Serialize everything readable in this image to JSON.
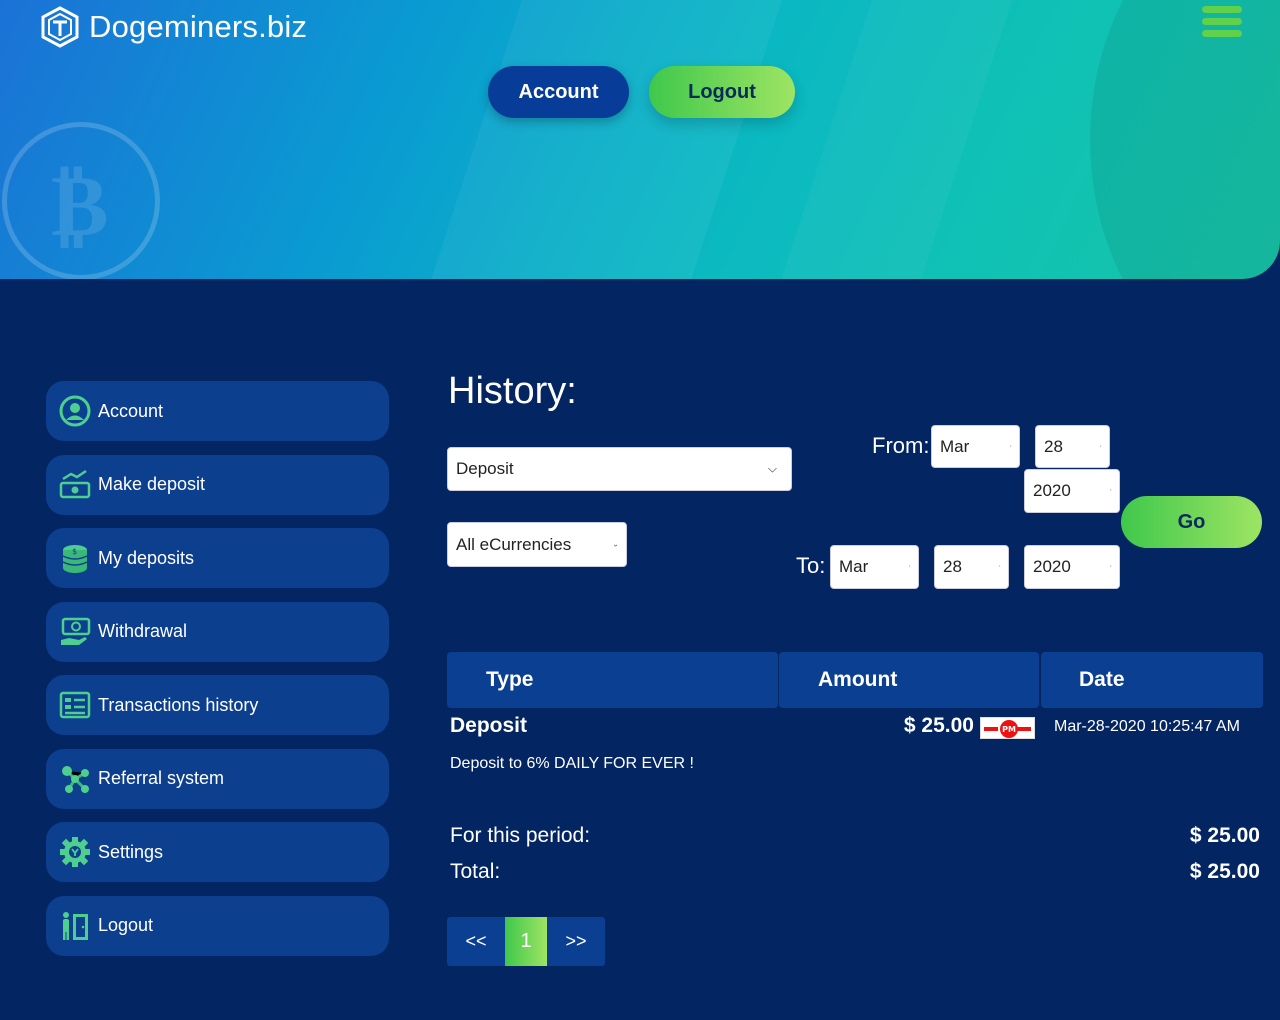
{
  "header": {
    "brand": "Dogeminers.biz",
    "account_button": "Account",
    "logout_button": "Logout"
  },
  "sidebar": {
    "items": [
      {
        "label": "Account",
        "icon": "user-circle-icon"
      },
      {
        "label": "Make deposit",
        "icon": "money-growth-icon"
      },
      {
        "label": "My deposits",
        "icon": "coin-stack-icon"
      },
      {
        "label": "Withdrawal",
        "icon": "cash-hand-icon"
      },
      {
        "label": "Transactions history",
        "icon": "list-icon"
      },
      {
        "label": "Referral system",
        "icon": "network-icon"
      },
      {
        "label": "Settings",
        "icon": "gear-icon"
      },
      {
        "label": "Logout",
        "icon": "door-exit-icon"
      }
    ]
  },
  "main": {
    "title": "History:",
    "type_select": "Deposit",
    "currency_select": "All eCurrencies",
    "from_label": "From:",
    "to_label": "To:",
    "from": {
      "month": "Mar",
      "day": "28",
      "year": "2020"
    },
    "to": {
      "month": "Mar",
      "day": "28",
      "year": "2020"
    },
    "go_button": "Go",
    "table": {
      "headers": [
        "Type",
        "Amount",
        "Date"
      ],
      "rows": [
        {
          "type": "Deposit",
          "amount": "$ 25.00",
          "payment_system": "PM",
          "date": "Mar-28-2020 10:25:47 AM",
          "description": "Deposit to 6% DAILY FOR EVER !"
        }
      ]
    },
    "summary": {
      "period_label": "For this period:",
      "period_value": "$ 25.00",
      "total_label": "Total:",
      "total_value": "$ 25.00"
    },
    "pagination": {
      "prev": "<<",
      "current": "1",
      "next": ">>"
    }
  },
  "colors": {
    "background": "#032562",
    "panel": "#0d3f8f",
    "accent_green": "#5fd14a",
    "accent_blue": "#073d98"
  }
}
